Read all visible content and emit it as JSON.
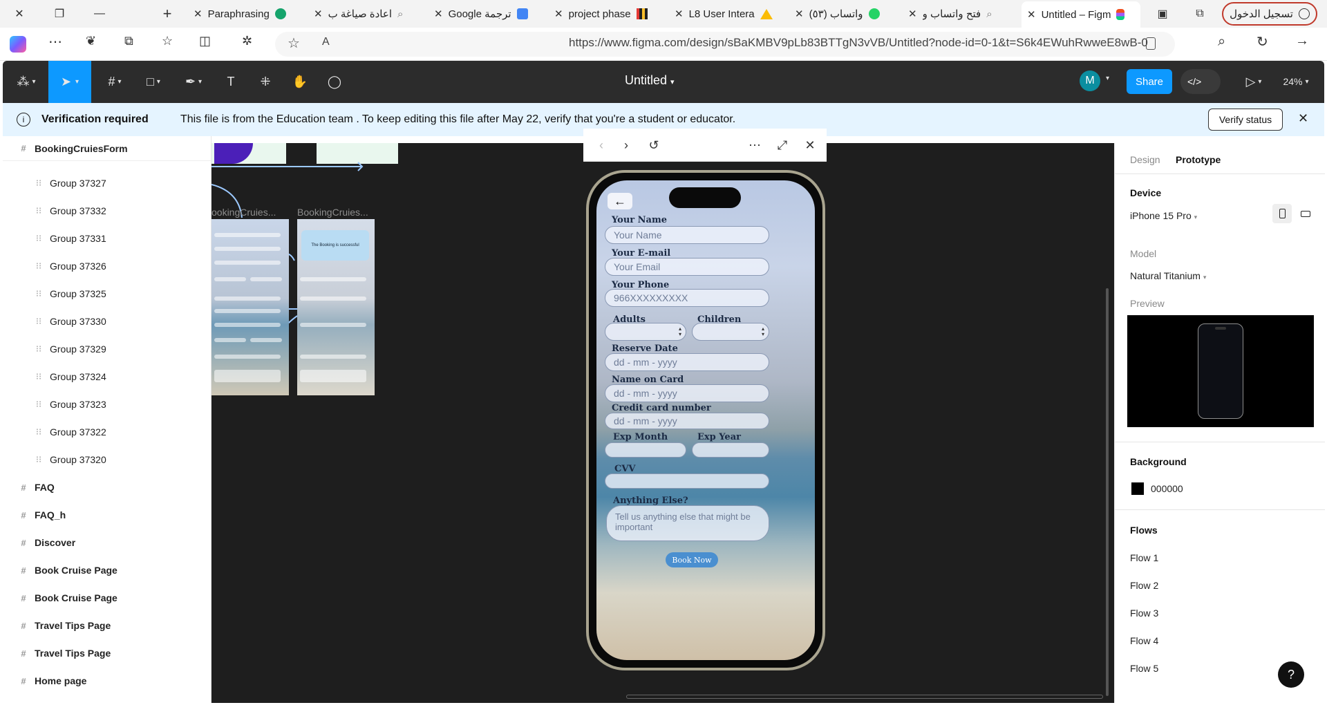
{
  "browser": {
    "tabs": [
      {
        "title": "Paraphrasing",
        "icon": "grammar-icon"
      },
      {
        "title": "اعادة صياغة ب",
        "icon": "search-icon"
      },
      {
        "title": "Google ترجمة",
        "icon": "translate-icon"
      },
      {
        "title": "project phase",
        "icon": "chart-icon"
      },
      {
        "title": "L8 User Intera",
        "icon": "drive-icon"
      },
      {
        "title": "(٥٣) واتساب",
        "icon": "whatsapp-icon"
      },
      {
        "title": "فتح واتساب و",
        "icon": "search-icon"
      },
      {
        "title": "Untitled – Figm",
        "icon": "figma-icon"
      }
    ],
    "login_label": "تسجيل الدخول",
    "url": "https://www.figma.com/design/sBaKMBV9pLb83BTTgN3vVB/Untitled?node-id=0-1&t=S6k4EWuhRwweE8wB-0"
  },
  "figma": {
    "doc_title": "Untitled",
    "share_label": "Share",
    "avatar_initial": "M",
    "zoom": "24%"
  },
  "banner": {
    "title": "Verification required",
    "message": "This file is from the Education team . To keep editing this file after May 22, verify that you're a student or educator.",
    "button": "Verify status"
  },
  "layers": {
    "frame_title": "BookingCruiesForm",
    "groups": [
      "Group 37327",
      "Group 37332",
      "Group 37331",
      "Group 37326",
      "Group 37325",
      "Group 37330",
      "Group 37329",
      "Group 37324",
      "Group 37323",
      "Group 37322",
      "Group 37320"
    ],
    "pages": [
      "FAQ",
      "FAQ_h",
      "Discover",
      "Book Cruise Page",
      "Book Cruise Page",
      "Travel Tips Page",
      "Travel Tips Page",
      "Home page"
    ]
  },
  "canvas": {
    "frame_label_1": "ookingCruies...",
    "frame_label_2": "BookingCruies...",
    "success_text": "The Booking is successful"
  },
  "form": {
    "name_label": "Your Name",
    "name_placeholder": "Your Name",
    "email_label": "Your E-mail",
    "email_placeholder": "Your Email",
    "phone_label": "Your Phone",
    "phone_placeholder": "966XXXXXXXXX",
    "adults_label": "Adults",
    "children_label": "Children",
    "reserve_label": "Reserve Date",
    "reserve_placeholder": "dd - mm - yyyy",
    "card_name_label": "Name on Card",
    "card_name_placeholder": "dd - mm - yyyy",
    "card_number_label": "Credit card number",
    "card_number_placeholder": "dd - mm - yyyy",
    "exp_month_label": "Exp Month",
    "exp_year_label": "Exp Year",
    "cvv_label": "CVV",
    "else_label": "Anything Else?",
    "else_placeholder": "Tell us anything else that might be important",
    "book_button": "Book Now"
  },
  "panel": {
    "tab_design": "Design",
    "tab_prototype": "Prototype",
    "device_heading": "Device",
    "device_value": "iPhone 15 Pro",
    "model_label": "Model",
    "model_value": "Natural Titanium",
    "preview_label": "Preview",
    "background_heading": "Background",
    "background_value": "000000",
    "flows_heading": "Flows",
    "flows": [
      "Flow 1",
      "Flow 2",
      "Flow 3",
      "Flow 4",
      "Flow 5"
    ],
    "help": "?"
  }
}
